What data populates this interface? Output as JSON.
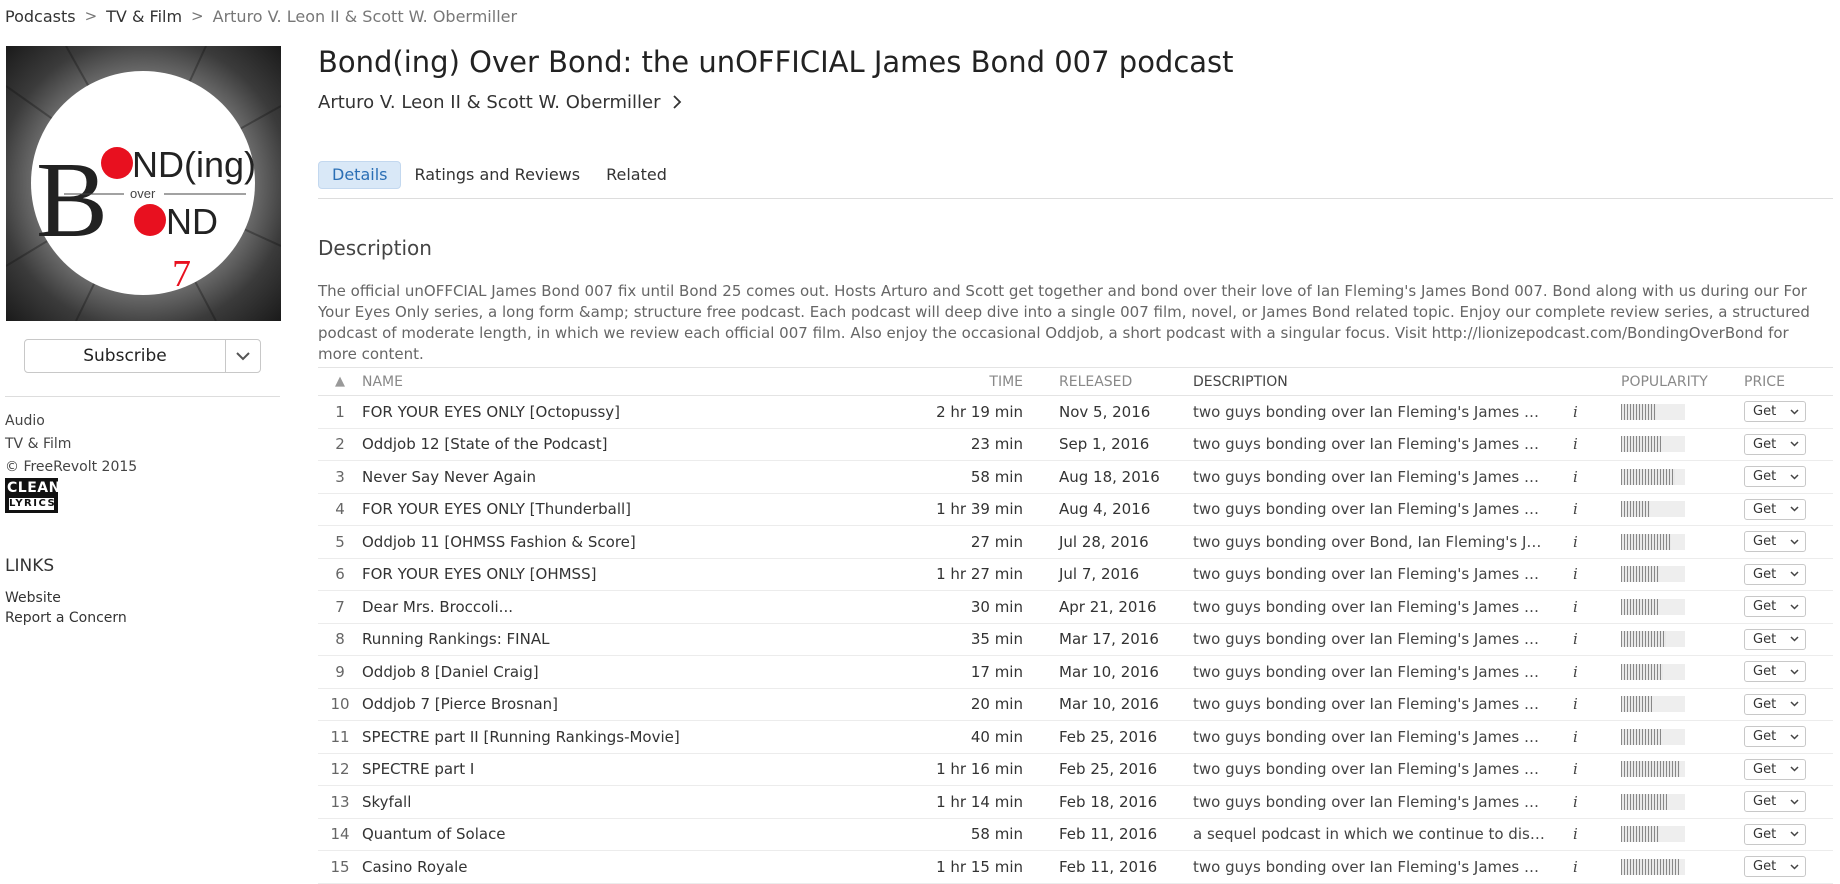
{
  "breadcrumb": [
    "Podcasts",
    "TV & Film",
    "Arturo V. Leon II & Scott W. Obermiller"
  ],
  "artwork": {
    "line1a": "B",
    "line1b": "ND(ing)",
    "over": "over",
    "line2b": "ND",
    "number": "7"
  },
  "subscribe_label": "Subscribe",
  "sidebar": {
    "meta": [
      "Audio",
      "TV & Film",
      "© FreeRevolt 2015"
    ],
    "badge_top": "CLEAN",
    "badge_bottom": "LYRICS",
    "links_heading": "LINKS",
    "links": [
      "Website",
      "Report a Concern"
    ]
  },
  "title": "Bond(ing) Over Bond: the unOFFICIAL James Bond 007 podcast",
  "artist": "Arturo V. Leon II & Scott W. Obermiller",
  "tabs": [
    "Details",
    "Ratings and Reviews",
    "Related"
  ],
  "description_heading": "Description",
  "description_text": "The official unOFFCIAL James Bond 007 fix until Bond 25 comes out. Hosts Arturo and Scott get together and bond over their love of Ian Fleming's James Bond 007. Bond along with us during our For Your Eyes Only series, a long form &amp; structure free podcast. Each podcast will deep dive into a single 007 film, novel, or James Bond related topic. Enjoy our complete review series, a structured podcast of moderate length, in which we review each official 007 film. Also enjoy the occasional Oddjob, a short podcast with a singular focus. Visit http://lionizepodcast.com/BondingOverBond for more content.",
  "table": {
    "sort_icon": "▲",
    "headers": {
      "name": "NAME",
      "time": "TIME",
      "released": "RELEASED",
      "description": "DESCRIPTION",
      "popularity": "POPULARITY",
      "price": "PRICE"
    },
    "info_glyph": "i",
    "get_label": "Get",
    "rows": [
      {
        "num": "1",
        "name": "FOR YOUR EYES ONLY [Octopussy]",
        "time": "2 hr 19 min",
        "released": "Nov 5, 2016",
        "desc": "two guys bonding over Ian Fleming's James Bo...",
        "pop": 0.55
      },
      {
        "num": "2",
        "name": "Oddjob 12 [State of the Podcast]",
        "time": "23 min",
        "released": "Sep 1, 2016",
        "desc": "two guys bonding over Ian Fleming's James Bo...",
        "pop": 0.62
      },
      {
        "num": "3",
        "name": "Never Say Never Again",
        "time": "58 min",
        "released": "Aug 18, 2016",
        "desc": "two guys bonding over Ian Fleming's James Bo...",
        "pop": 0.85
      },
      {
        "num": "4",
        "name": "FOR YOUR EYES ONLY [Thunderball]",
        "time": "1 hr 39 min",
        "released": "Aug 4, 2016",
        "desc": "two guys bonding over Ian Fleming's James Bo...",
        "pop": 0.45
      },
      {
        "num": "5",
        "name": "Oddjob 11 [OHMSS Fashion & Score]",
        "time": "27 min",
        "released": "Jul 28, 2016",
        "desc": "two guys bonding over Bond, Ian Fleming's Ja...",
        "pop": 0.78
      },
      {
        "num": "6",
        "name": "FOR YOUR EYES ONLY [OHMSS]",
        "time": "1 hr 27 min",
        "released": "Jul 7, 2016",
        "desc": "two guys bonding over Ian Fleming's James Bo...",
        "pop": 0.6
      },
      {
        "num": "7",
        "name": "Dear Mrs. Broccoli...",
        "time": "30 min",
        "released": "Apr 21, 2016",
        "desc": "two guys bonding over Ian Fleming's James Bo...",
        "pop": 0.58
      },
      {
        "num": "8",
        "name": "Running Rankings: FINAL",
        "time": "35 min",
        "released": "Mar 17, 2016",
        "desc": "two guys bonding over Ian Fleming's James Bo...",
        "pop": 0.7
      },
      {
        "num": "9",
        "name": "Oddjob 8 [Daniel Craig]",
        "time": "17 min",
        "released": "Mar 10, 2016",
        "desc": "two guys bonding over Ian Fleming's James Bo...",
        "pop": 0.65
      },
      {
        "num": "10",
        "name": "Oddjob 7 [Pierce Brosnan]",
        "time": "20 min",
        "released": "Mar 10, 2016",
        "desc": "two guys bonding over Ian Fleming's James Bo...",
        "pop": 0.48
      },
      {
        "num": "11",
        "name": "SPECTRE part II [Running Rankings-Movie]",
        "time": "40 min",
        "released": "Feb 25, 2016",
        "desc": "two guys bonding over Ian Fleming's James Bo...",
        "pop": 0.62
      },
      {
        "num": "12",
        "name": "SPECTRE part I",
        "time": "1 hr 16 min",
        "released": "Feb 25, 2016",
        "desc": "two guys bonding over Ian Fleming's James Bo...",
        "pop": 0.92
      },
      {
        "num": "13",
        "name": "Skyfall",
        "time": "1 hr 14 min",
        "released": "Feb 18, 2016",
        "desc": "two guys bonding over Ian Fleming's James Bo...",
        "pop": 0.72
      },
      {
        "num": "14",
        "name": "Quantum of Solace",
        "time": "58 min",
        "released": "Feb 11, 2016",
        "desc": "a sequel podcast in which we continue to discu...",
        "pop": 0.6
      },
      {
        "num": "15",
        "name": "Casino Royale",
        "time": "1 hr 15 min",
        "released": "Feb 11, 2016",
        "desc": "two guys bonding over Ian Fleming's James Bo...",
        "pop": 0.9
      }
    ]
  },
  "colors": {
    "accent": "#2b6fb5",
    "tab_bg": "#d9e8f7",
    "artwork_red": "#e8101f"
  }
}
